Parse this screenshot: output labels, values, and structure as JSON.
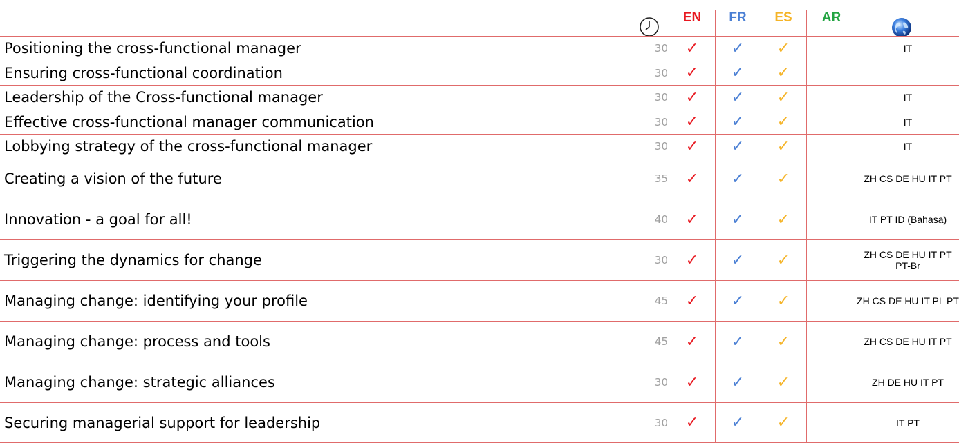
{
  "header": {
    "clock_icon": "clock-icon",
    "globe_icon": "globe-icon",
    "languages": [
      {
        "code": "EN",
        "color": "#e8171f"
      },
      {
        "code": "FR",
        "color": "#4a7fd4"
      },
      {
        "code": "ES",
        "color": "#f5b428"
      },
      {
        "code": "AR",
        "color": "#23a442"
      }
    ]
  },
  "check_glyph": "✓",
  "rows": [
    {
      "title": "Positioning the cross-functional manager",
      "duration": "30",
      "en": true,
      "fr": true,
      "es": true,
      "ar": false,
      "other": "IT"
    },
    {
      "title": "Ensuring cross-functional coordination",
      "duration": "30",
      "en": true,
      "fr": true,
      "es": true,
      "ar": false,
      "other": ""
    },
    {
      "title": "Leadership of the Cross-functional manager",
      "duration": "30",
      "en": true,
      "fr": true,
      "es": true,
      "ar": false,
      "other": "IT"
    },
    {
      "title": "Effective cross-functional manager communication",
      "duration": "30",
      "en": true,
      "fr": true,
      "es": true,
      "ar": false,
      "other": "IT"
    },
    {
      "title": "Lobbying strategy of the cross-functional manager",
      "duration": "30",
      "en": true,
      "fr": true,
      "es": true,
      "ar": false,
      "other": "IT"
    },
    {
      "title": "Creating a vision of the future",
      "duration": "35",
      "en": true,
      "fr": true,
      "es": true,
      "ar": false,
      "other": "ZH CS DE HU IT PT"
    },
    {
      "title": "Innovation - a goal for all!",
      "duration": "40",
      "en": true,
      "fr": true,
      "es": true,
      "ar": false,
      "other": "IT PT ID (Bahasa)"
    },
    {
      "title": "Triggering the dynamics for change",
      "duration": "30",
      "en": true,
      "fr": true,
      "es": true,
      "ar": false,
      "other": "ZH CS DE HU IT PT PT-Br"
    },
    {
      "title": "Managing change: identifying your profile",
      "duration": "45",
      "en": true,
      "fr": true,
      "es": true,
      "ar": false,
      "other": "ZH CS DE HU IT PL PT"
    },
    {
      "title": "Managing change: process and tools",
      "duration": "45",
      "en": true,
      "fr": true,
      "es": true,
      "ar": false,
      "other": "ZH CS DE HU IT PT"
    },
    {
      "title": "Managing change: strategic alliances",
      "duration": "30",
      "en": true,
      "fr": true,
      "es": true,
      "ar": false,
      "other": "ZH DE HU IT PT"
    },
    {
      "title": "Securing managerial support for leadership",
      "duration": "30",
      "en": true,
      "fr": true,
      "es": true,
      "ar": false,
      "other": "IT PT"
    }
  ]
}
